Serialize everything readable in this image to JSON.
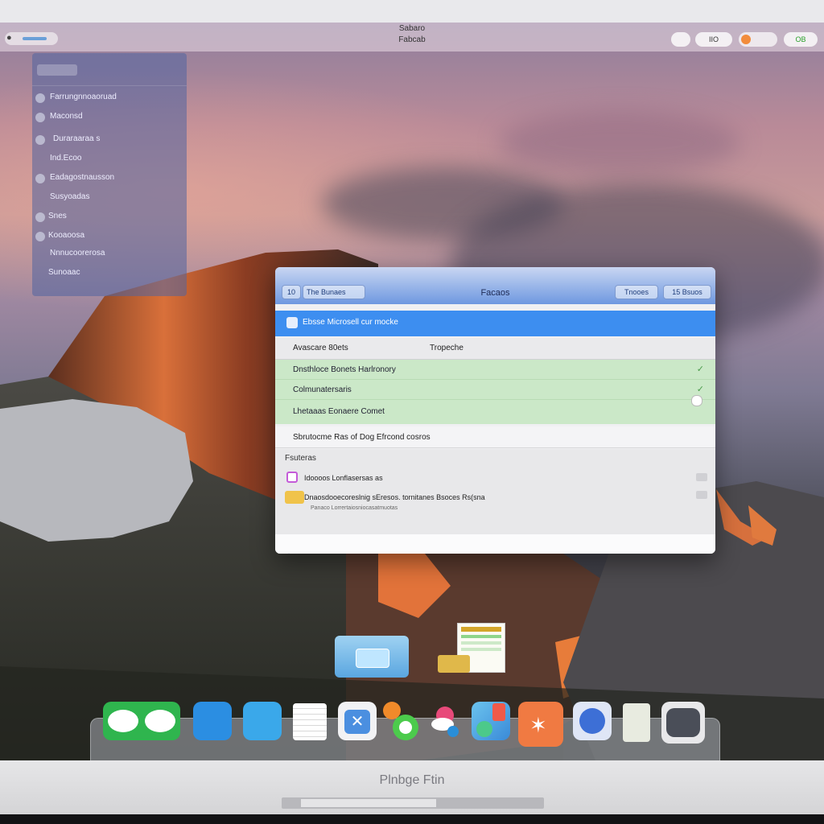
{
  "menubar": {
    "title_line1": "Sabaro",
    "title_line2": "Fabcab",
    "right_pill_1": "",
    "right_pill_2": "IIO",
    "right_pill_3": "",
    "right_pill_4": "",
    "right_pill_4_text": "OB"
  },
  "sidebar": {
    "items": [
      {
        "label": "Farrungnnoaoruad",
        "icon": "circle-icon"
      },
      {
        "label": "Maconsd",
        "icon": "circle-icon"
      },
      {
        "label": "Duraraaraa s",
        "icon": "circle-icon"
      },
      {
        "label": "Ind.Ecoo",
        "icon": "circle-icon"
      },
      {
        "label": "Eadagostnausson",
        "icon": "circle-icon"
      },
      {
        "label": "Susyoadas",
        "icon": "circle-icon"
      },
      {
        "label": "Snes",
        "icon": "circle-icon"
      },
      {
        "label": "Kooaoosa",
        "icon": "circle-icon"
      },
      {
        "label": "Nnnucoorerosa",
        "icon": "circle-icon"
      },
      {
        "label": "Sunoaac",
        "icon": "circle-icon"
      }
    ]
  },
  "dialog": {
    "title": "Facaos",
    "left_button": "10",
    "left_field": "The Bunaes",
    "right_button_1": "Tnooes",
    "right_button_2": "15 Bsuos",
    "selected_row": "Ebsse Microsell cur mocke",
    "header_col1": "Avascare 80ets",
    "header_col2": "Tropeche",
    "green_rows": [
      "Dnsthloce Bonets Harlronory",
      "Colmunatersaris",
      "Lhetaaas Eonaere Comet"
    ],
    "plain_row": "Sbrutocme Ras of Dog Efrcond cosros",
    "section_title": "Fsuteras",
    "section_rows": [
      "Idoooos Lonflasersas as",
      "Dnaosdooecoreslnig sEresos. tornitanes Bsoces Rs(sna"
    ],
    "section_subnote": "Panaco   Lorrertaiosniocasatmuotas"
  },
  "dock": {
    "icons": [
      {
        "name": "messages-icon",
        "color": "#27b04b"
      },
      {
        "name": "files-icon",
        "color": "#2a8de0"
      },
      {
        "name": "assistant-icon",
        "color": "#2f9fe8"
      },
      {
        "name": "notes-icon",
        "color": "#f4f4f4"
      },
      {
        "name": "calendar-icon",
        "color": "#ffffff"
      },
      {
        "name": "photos-icon",
        "color": "#ffffff"
      },
      {
        "name": "games-icon",
        "color": "#ffffff"
      },
      {
        "name": "maps-icon",
        "color": "#5fb1e8"
      },
      {
        "name": "sketch-icon",
        "color": "#f47f4a"
      },
      {
        "name": "safari-icon",
        "color": "#3d6fd6"
      },
      {
        "name": "document-icon",
        "color": "#eceee6"
      },
      {
        "name": "camera-icon",
        "color": "#e6e6e8"
      }
    ]
  },
  "bezel": {
    "brand": "Plnbge Ftin"
  }
}
